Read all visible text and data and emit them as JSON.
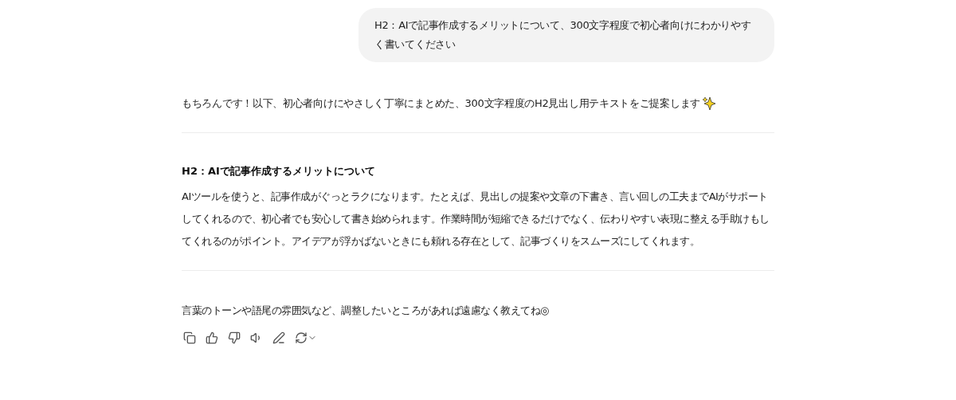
{
  "user_message": {
    "text": "H2：AIで記事作成するメリットについて、300文字程度で初心者向けにわかりやすく書いてください"
  },
  "assistant_message": {
    "intro": "もちろんです！以下、初心者向けにやさしく丁寧にまとめた、300文字程度のH2見出し用テキストをご提案します",
    "heading": "H2：AIで記事作成するメリットについて",
    "body": "AIツールを使うと、記事作成がぐっとラクになります。たとえば、見出しの提案や文章の下書き、言い回しの工夫までAIがサポートしてくれるので、初心者でも安心して書き始められます。作業時間が短縮できるだけでなく、伝わりやすい表現に整える手助けもしてくれるのがポイント。アイデアが浮かばないときにも頼れる存在として、記事づくりをスムーズにしてくれます。",
    "closing": "言葉のトーンや語尾の雰囲気など、調整したいところがあれば遠慮なく教えてね◎"
  }
}
